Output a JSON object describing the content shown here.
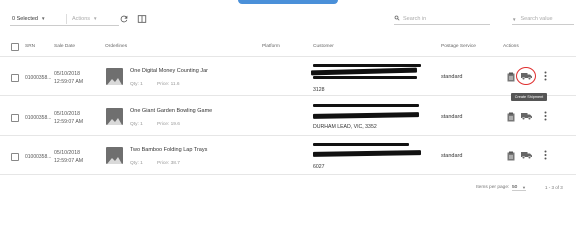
{
  "toolbar": {
    "selected_label": "0 Selected",
    "actions_label": "Actions",
    "search_placeholder": "Search in",
    "search_value_placeholder": "Search value"
  },
  "table": {
    "headers": {
      "srn": "SRN",
      "sale_date": "Sale Date",
      "orderlines": "Orderlines",
      "platform": "Platform",
      "customer": "Customer",
      "postage_service": "Postage Service",
      "actions": "Actions"
    },
    "rows": [
      {
        "srn": "01000358...",
        "date": "05/10/2018",
        "time": "12:59:07 AM",
        "product": "One Digital Money Counting Jar",
        "qty": "Qty: 1",
        "price": "Price: 11.6",
        "customer_visible": "3128",
        "postage": "standard"
      },
      {
        "srn": "01000358...",
        "date": "05/10/2018",
        "time": "12:59:07 AM",
        "product": "One Giant Garden Bowling Game",
        "qty": "Qty: 1",
        "price": "Price: 19.6",
        "customer_visible": "DURHAM LEAD, VIC, 3352",
        "postage": "standard"
      },
      {
        "srn": "01000358...",
        "date": "05/10/2018",
        "time": "12:59:07 AM",
        "product": "Two Bamboo Folding Lap Trays",
        "qty": "Qty: 1",
        "price": "Price: 38.7",
        "customer_visible": "6027",
        "postage": "standard"
      }
    ]
  },
  "tooltip": "Create Shipment",
  "footer": {
    "items_per_page_label": "Items per page:",
    "items_per_page_value": "50",
    "range": "1 - 3 of 3"
  },
  "colors": {
    "highlight_circle": "#e03030",
    "accent_top": "#4a90d9"
  },
  "icons": {
    "refresh": "refresh-icon",
    "columns": "columns-icon",
    "search": "search-icon",
    "clipboard": "clipboard-icon",
    "truck": "truck-icon",
    "more": "more-vert-icon",
    "image": "image-placeholder-icon"
  }
}
